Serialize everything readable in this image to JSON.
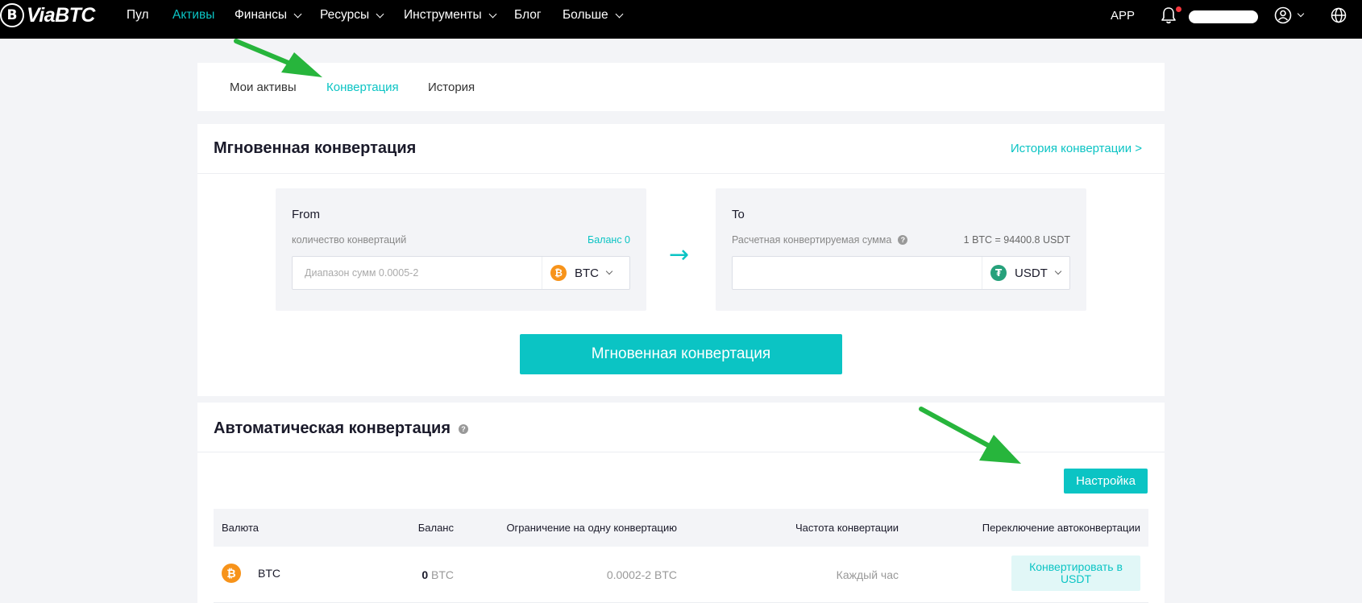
{
  "header": {
    "logo_mark": "B",
    "logo_text": "ViaBTC",
    "nav": [
      {
        "label": "Пул"
      },
      {
        "label": "Активы"
      },
      {
        "label": "Финансы"
      },
      {
        "label": "Ресурсы"
      },
      {
        "label": "Инструменты"
      },
      {
        "label": "Блог"
      },
      {
        "label": "Больше"
      }
    ],
    "app_label": "APP"
  },
  "tabs": [
    {
      "label": "Мои активы"
    },
    {
      "label": "Конвертация"
    },
    {
      "label": "История"
    }
  ],
  "instant": {
    "title": "Мгновенная конвертация",
    "history_link": "История конвертации >",
    "from": {
      "title": "From",
      "sub_label": "количество конвертаций",
      "balance": "Баланс 0",
      "placeholder": "Диапазон сумм 0.0005-2",
      "coin": "BTC",
      "coin_icon": "₿"
    },
    "to": {
      "title": "To",
      "sub_label": "Расчетная конвертируемая сумма",
      "help_icon": "?",
      "rate": "1 BTC = 94400.8 USDT",
      "coin": "USDT",
      "coin_icon": "₮"
    },
    "arrow": "→",
    "button": "Мгновенная конвертация"
  },
  "auto": {
    "title": "Автоматическая конвертация",
    "help_icon": "?",
    "settings_button": "Настройка",
    "columns": [
      "Валюта",
      "Баланс",
      "Ограничение на одну конвертацию",
      "Частота конвертации",
      "Переключение автоконвертации"
    ],
    "rows": [
      {
        "coin": "BTC",
        "coin_icon": "₿",
        "balance_value": "0",
        "balance_unit": "BTC",
        "limit": "0.0002-2 BTC",
        "frequency": "Каждый час",
        "toggle_label": "Конвертировать в  USDT"
      }
    ]
  },
  "colors": {
    "accent": "#0bc4c4",
    "topbar": "#000000",
    "background": "#f3f4f7",
    "annotation_arrow": "#27b53c",
    "btc": "#f7931a",
    "usdt": "#26a17b"
  }
}
